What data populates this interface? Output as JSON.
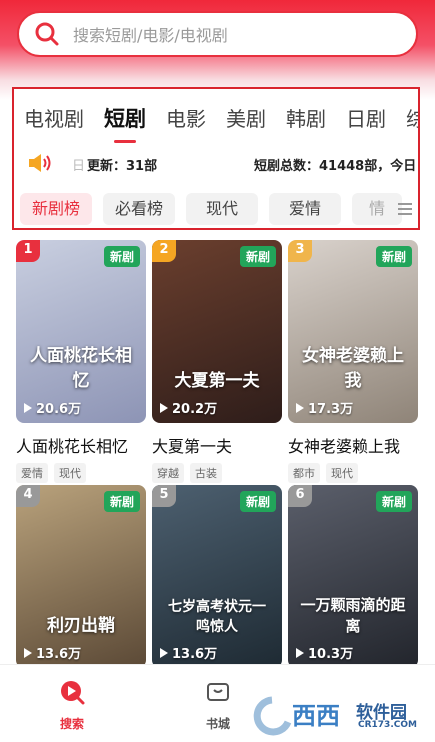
{
  "search": {
    "placeholder": "搜索短剧/电影/电视剧"
  },
  "tabs": [
    {
      "label": "电视剧",
      "active": false
    },
    {
      "label": "短剧",
      "active": true
    },
    {
      "label": "电影",
      "active": false
    },
    {
      "label": "美剧",
      "active": false
    },
    {
      "label": "韩剧",
      "active": false
    },
    {
      "label": "日剧",
      "active": false
    },
    {
      "label": "综",
      "active": false
    }
  ],
  "stats": {
    "faded_char": "日",
    "update_text": "更新：31部",
    "total_text": "短剧总数：41448部，今日"
  },
  "chips": [
    {
      "label": "新剧榜",
      "active": true
    },
    {
      "label": "必看榜",
      "active": false
    },
    {
      "label": "现代",
      "active": false
    },
    {
      "label": "爱情",
      "active": false
    },
    {
      "label": "情",
      "active": false
    }
  ],
  "dramas": [
    {
      "rank": "1",
      "rank_color": "#e8303e",
      "badge": "新剧",
      "views": "20.6万",
      "poster_title": "人面桃花长相忆",
      "name": "人面桃花长相忆",
      "tags": [
        "爱情",
        "现代"
      ],
      "colors": [
        "#c9cfe0",
        "#8d94b5"
      ]
    },
    {
      "rank": "2",
      "rank_color": "#f5a623",
      "badge": "新剧",
      "views": "20.2万",
      "poster_title": "大夏第一夫",
      "name": "大夏第一夫",
      "tags": [
        "穿越",
        "古装"
      ],
      "colors": [
        "#6b3f2e",
        "#2e1d1a"
      ]
    },
    {
      "rank": "3",
      "rank_color": "#f0b54b",
      "badge": "新剧",
      "views": "17.3万",
      "poster_title": "女神老婆赖上我",
      "name": "女神老婆赖上我",
      "tags": [
        "都市",
        "现代"
      ],
      "colors": [
        "#d9d2cc",
        "#8f8478"
      ]
    },
    {
      "rank": "4",
      "rank_color": "#999999",
      "badge": "新剧",
      "views": "13.6万",
      "poster_title": "利刃出鞘",
      "name": "",
      "tags": [],
      "colors": [
        "#b9a27c",
        "#5b4936"
      ]
    },
    {
      "rank": "5",
      "rank_color": "#999999",
      "badge": "新剧",
      "views": "13.6万",
      "poster_title": "七岁高考状元一鸣惊人",
      "name": "",
      "tags": [],
      "colors": [
        "#4d6070",
        "#1e2a33"
      ]
    },
    {
      "rank": "6",
      "rank_color": "#999999",
      "badge": "新剧",
      "views": "10.3万",
      "poster_title": "一万颗雨滴的距离",
      "name": "",
      "tags": [],
      "colors": [
        "#5b5f6b",
        "#22252c"
      ]
    }
  ],
  "bottom_nav": [
    {
      "label": "搜索",
      "icon": "search-play-icon",
      "active": true,
      "color": "#e8303e"
    },
    {
      "label": "书城",
      "icon": "book-icon",
      "active": false,
      "color": "#555555"
    }
  ],
  "watermark": {
    "brand": "西西",
    "site": "软件园",
    "url": "CR173.COM"
  }
}
